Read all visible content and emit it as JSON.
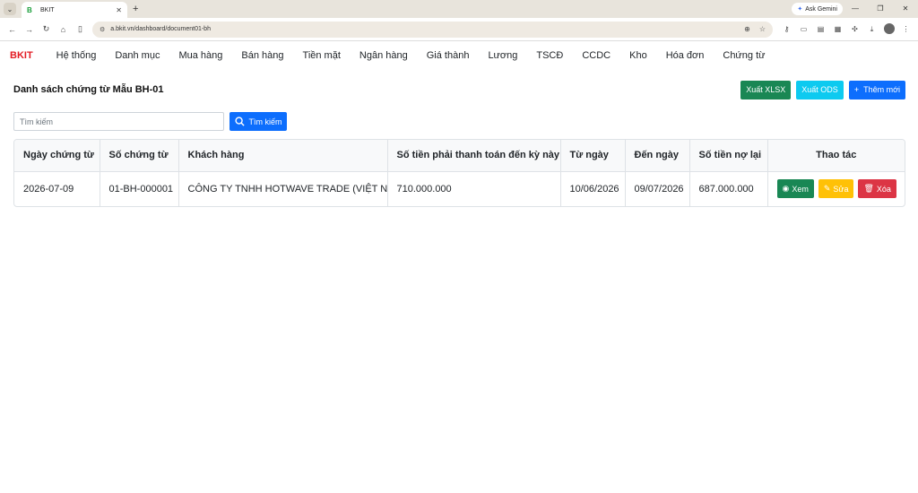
{
  "browser": {
    "tab_title": "BKIT",
    "tab_favicon": "B",
    "url": "a.bkit.vn/dashboard/document01-bh",
    "gemini_label": "Ask Gemini"
  },
  "appnav": {
    "brand": "BKIT",
    "brand_color": "#e31b23",
    "items": [
      "Hệ thống",
      "Danh mục",
      "Mua hàng",
      "Bán hàng",
      "Tiền mặt",
      "Ngân hàng",
      "Giá thành",
      "Lương",
      "TSCĐ",
      "CCDC",
      "Kho",
      "Hóa đơn",
      "Chứng từ"
    ]
  },
  "page": {
    "title": "Danh sách chứng từ Mẫu BH-01",
    "actions": {
      "export_xlsx": "Xuất XLSX",
      "export_ods": "Xuất ODS",
      "add_new": "Thêm mới"
    },
    "search": {
      "placeholder": "Tìm kiếm",
      "button": "Tìm kiếm"
    }
  },
  "table": {
    "headers": [
      "Ngày chứng từ",
      "Số chứng từ",
      "Khách hàng",
      "Số tiền phải thanh toán đến kỳ này",
      "Từ ngày",
      "Đến ngày",
      "Số tiền nợ lại",
      "Thao tác"
    ],
    "rows": [
      {
        "date": "2026-07-09",
        "number": "01-BH-000001",
        "customer": "CÔNG TY TNHH HOTWAVE TRADE (VIỆT NAM)",
        "amount_due": "710.000.000",
        "from_date": "10/06/2026",
        "to_date": "09/07/2026",
        "remaining": "687.000.000"
      }
    ],
    "row_actions": {
      "view": "Xem",
      "edit": "Sửa",
      "delete": "Xóa"
    }
  },
  "colors": {
    "green": "#198754",
    "cyan": "#0dcaf0",
    "blue": "#0d6efd",
    "yellow": "#ffc107",
    "red": "#dc3545"
  }
}
